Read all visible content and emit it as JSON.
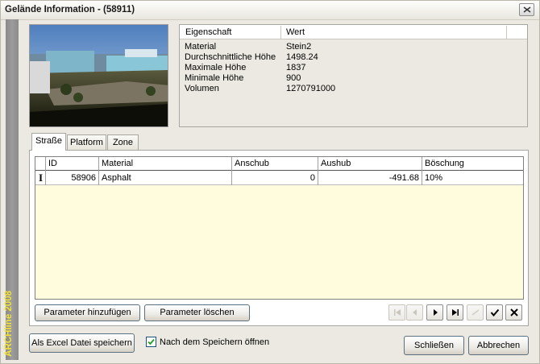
{
  "window": {
    "title": "Gelände Information - (58911)",
    "brand": "ARCHline 2008",
    "close_icon": "close-icon"
  },
  "properties": {
    "columns": [
      "Eigenschaft",
      "Wert"
    ],
    "rows": [
      {
        "key": "Material",
        "value": "Stein2"
      },
      {
        "key": "Durchschnittliche Höhe",
        "value": "1498.24"
      },
      {
        "key": "Maximale Höhe",
        "value": "1837"
      },
      {
        "key": "Minimale Höhe",
        "value": "900"
      },
      {
        "key": "Volumen",
        "value": "1270791000"
      }
    ]
  },
  "tabs": [
    {
      "label": "Straße",
      "active": true
    },
    {
      "label": "Platform",
      "active": false
    },
    {
      "label": "Zone",
      "active": false
    }
  ],
  "grid": {
    "columns": [
      "ID",
      "Material",
      "Anschub",
      "Aushub",
      "Böschung"
    ],
    "rows": [
      {
        "id": "58906",
        "material": "Asphalt",
        "anschub": "0",
        "aushub": "-491.68",
        "boeschung": "10%"
      }
    ],
    "row_indicator": "I"
  },
  "buttons": {
    "add_param": "Parameter hinzufügen",
    "delete_param": "Parameter löschen",
    "save_excel": "Als Excel Datei speichern",
    "close": "Schließen",
    "cancel": "Abbrechen"
  },
  "open_after_save": {
    "label": "Nach dem Speichern öffnen",
    "checked": true
  },
  "navigator": [
    {
      "icon": "first-record-icon",
      "enabled": false
    },
    {
      "icon": "prior-record-icon",
      "enabled": false
    },
    {
      "icon": "next-record-icon",
      "enabled": true
    },
    {
      "icon": "last-record-icon",
      "enabled": true
    },
    {
      "icon": "edit-record-icon",
      "enabled": false
    },
    {
      "icon": "post-edit-icon",
      "enabled": true
    },
    {
      "icon": "cancel-edit-icon",
      "enabled": true
    }
  ],
  "colors": {
    "grid_background": "#fffbdd",
    "brand_text": "#f2e33a",
    "side_band": "#8a8a8a",
    "dialog_background": "#ebe9e1"
  }
}
